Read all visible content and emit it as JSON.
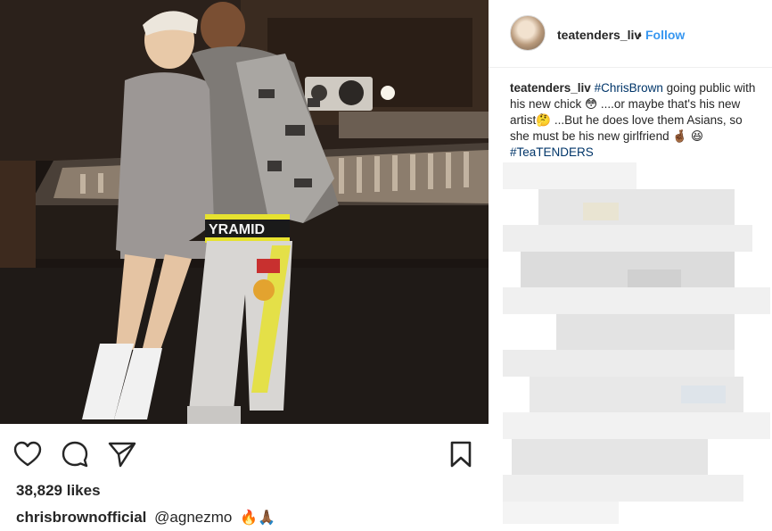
{
  "post": {
    "image_alt": "Photo of two people posing in a recording studio"
  },
  "actions": {
    "like_icon": "heart-icon",
    "comment_icon": "comment-icon",
    "share_icon": "share-icon",
    "save_icon": "bookmark-icon"
  },
  "likes": "38,829 likes",
  "caption": {
    "username": "chrisbrownofficial",
    "text": "@agnezmo",
    "emoji": "🔥🙏🏾"
  },
  "header": {
    "username": "teatenders_liv",
    "separator": "•",
    "follow_label": "Follow"
  },
  "comment": {
    "username": "teatenders_liv",
    "hashtag1": "#ChrisBrown",
    "text1": " going public with his new chick 😳 ....or maybe that's his new artist🤔 ...But he does love them Asians, so she must be his new girlfriend 🤞🏾",
    "hashtag2": "#TeaTENDERS",
    "emoji2": "😆"
  },
  "colors": {
    "link": "#3897f0",
    "hashtag": "#003569",
    "text": "#262626"
  }
}
